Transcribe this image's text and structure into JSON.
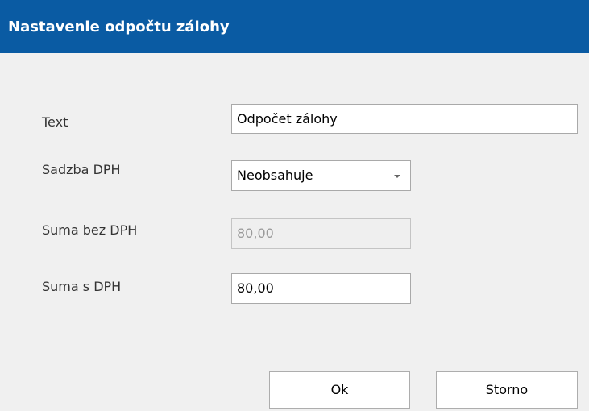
{
  "dialog": {
    "title": "Nastavenie odpočtu zálohy",
    "colors": {
      "title_bar": "#0a5ba3",
      "background": "#f0f0f0"
    }
  },
  "form": {
    "text": {
      "label": "Text",
      "value": "Odpočet zálohy"
    },
    "vat_rate": {
      "label": "Sadzba DPH",
      "selected": "Neobsahuje",
      "icon": "chevron-down-icon"
    },
    "amount_without_vat": {
      "label": "Suma bez DPH",
      "value": "80,00",
      "disabled": true
    },
    "amount_with_vat": {
      "label": "Suma s DPH",
      "value": "80,00"
    }
  },
  "buttons": {
    "ok_label": "Ok",
    "cancel_label": "Storno"
  }
}
